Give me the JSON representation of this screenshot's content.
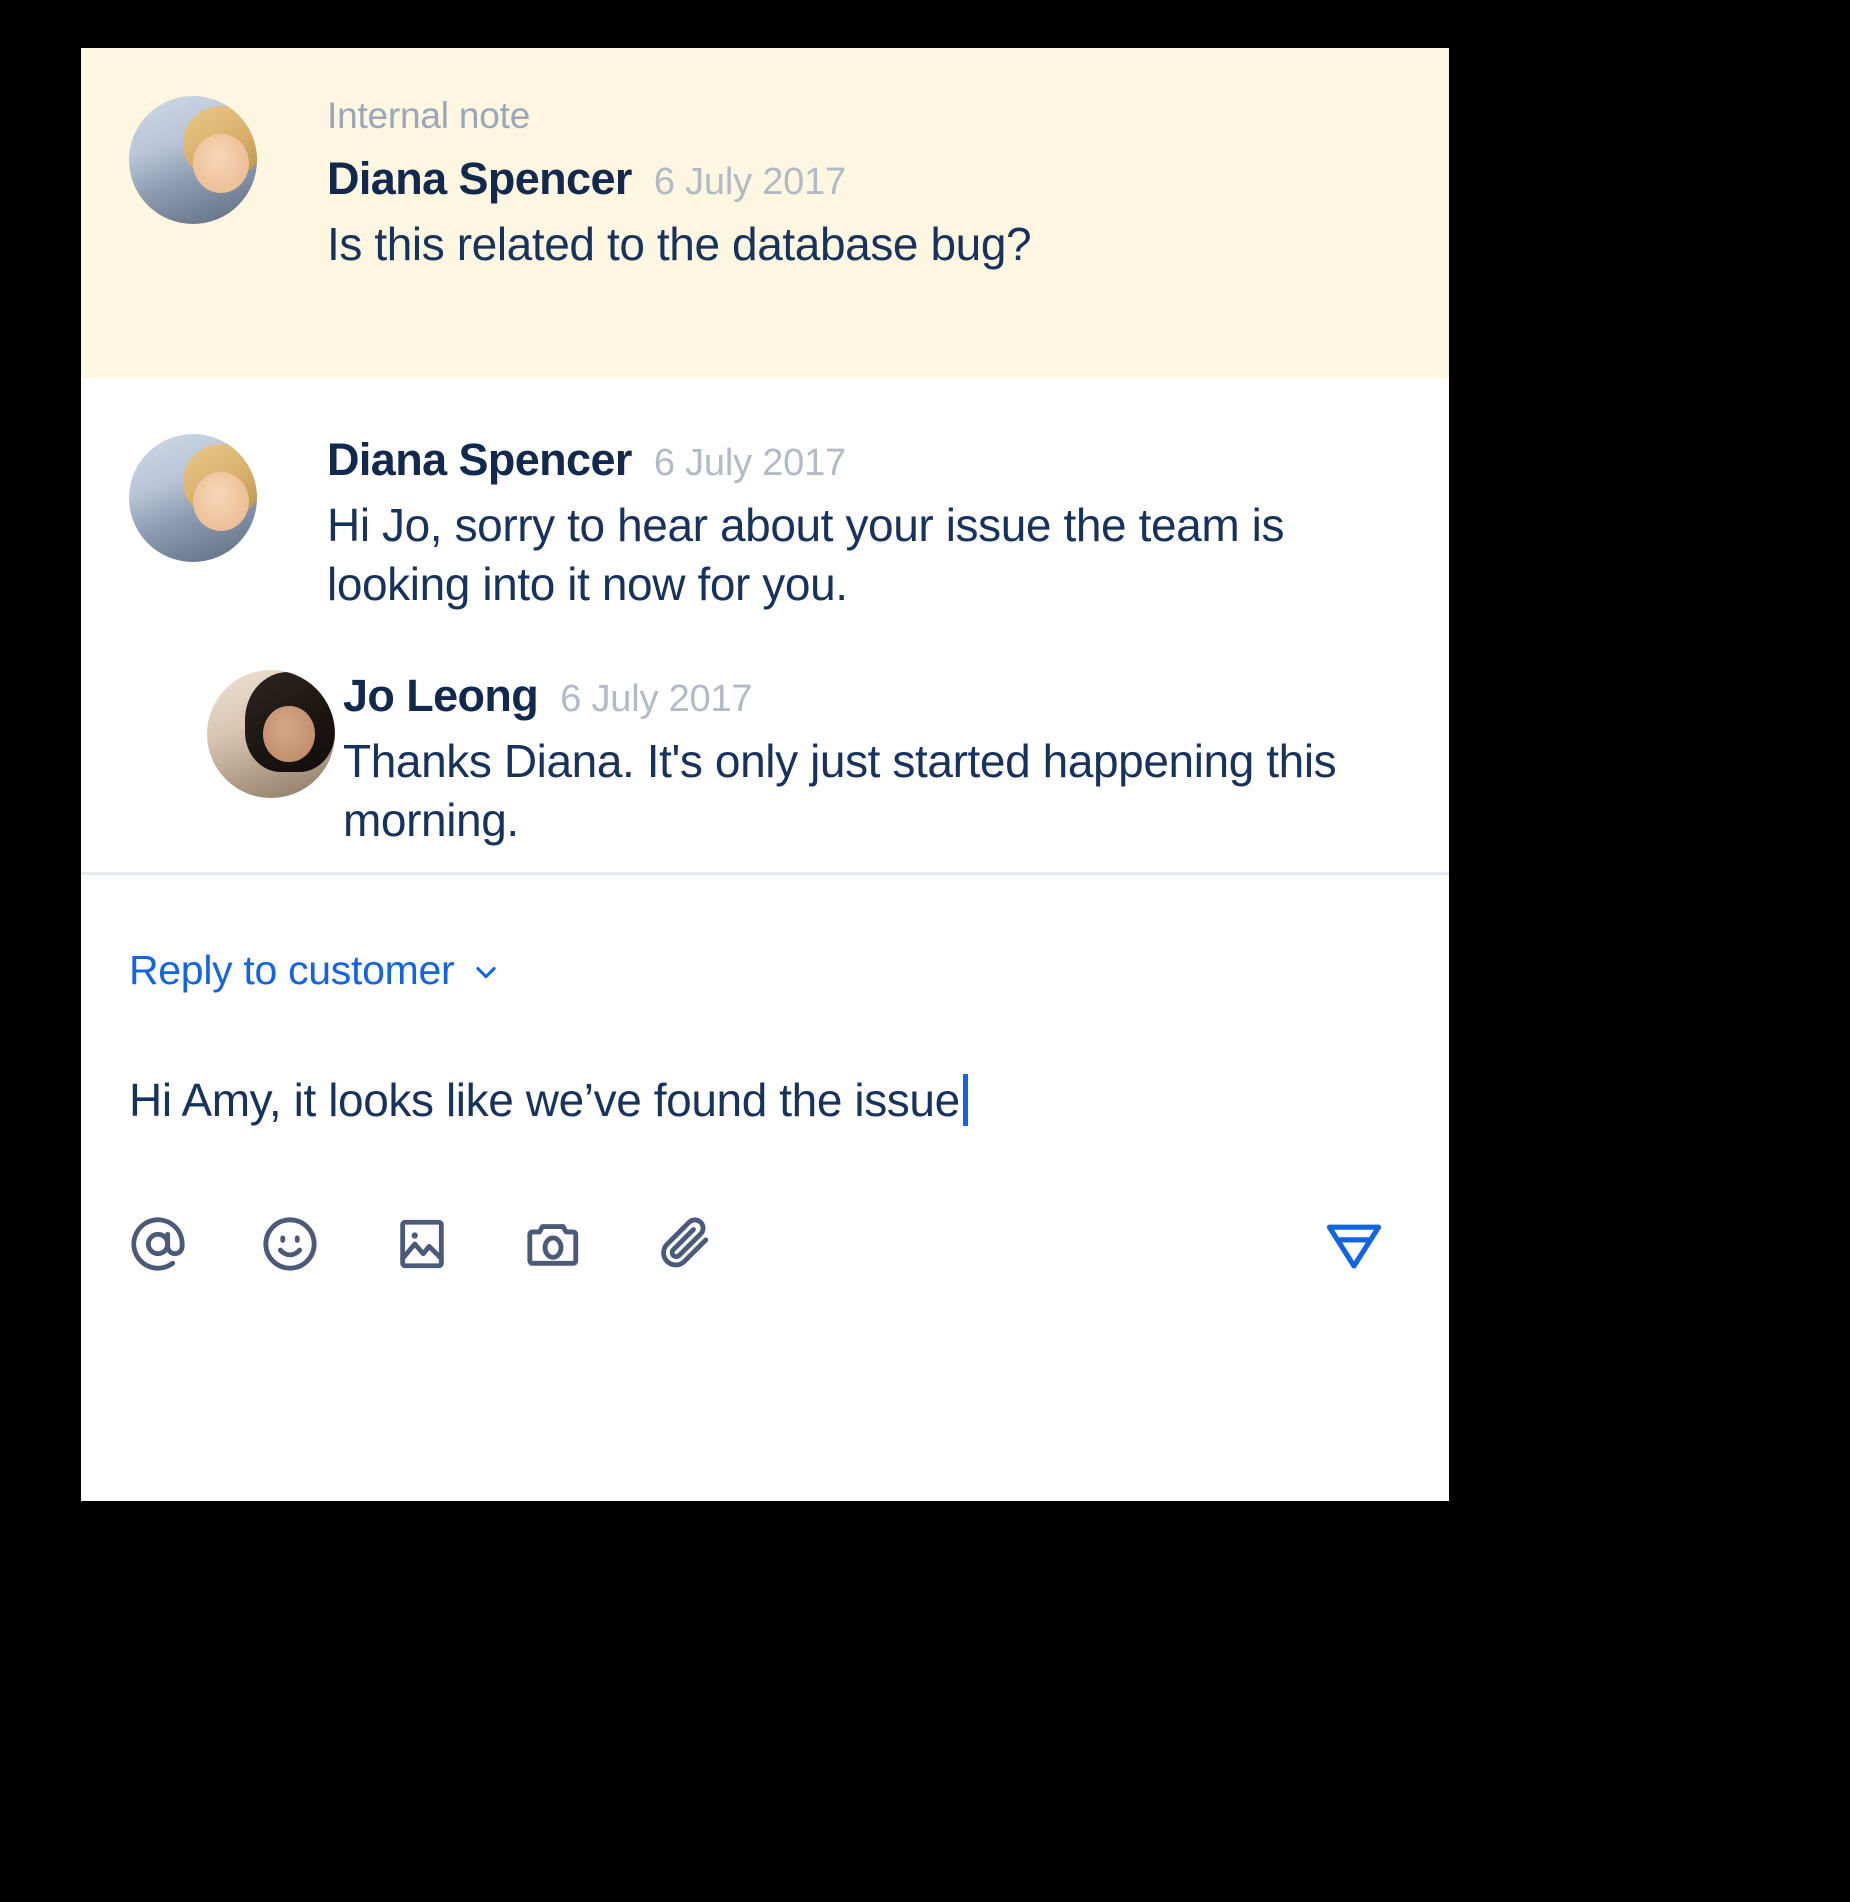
{
  "colors": {
    "note_background": "#fdf6e0",
    "card_background": "#ffffff",
    "page_background": "#000000",
    "text_primary": "#17325c",
    "text_muted": "#b2bac6",
    "label_muted": "#9ba7b8",
    "accent_blue": "#1264e0",
    "icon_gray": "#4a5a78",
    "divider": "#e4e9f0"
  },
  "internal_note": {
    "label": "Internal note",
    "author": "Diana Spencer",
    "timestamp": "6 July 2017",
    "body": "Is this related to the database bug?",
    "avatar_name": "diana-avatar"
  },
  "thread": {
    "messages": [
      {
        "author": "Diana Spencer",
        "timestamp": "6 July 2017",
        "body": "Hi Jo, sorry to hear about your issue the team is looking into it now for you.",
        "avatar_name": "diana-avatar"
      },
      {
        "author": "Jo Leong",
        "timestamp": "6 July 2017",
        "body": "Thanks Diana. It's only just started happening this morning.",
        "avatar_name": "jo-avatar"
      }
    ]
  },
  "composer": {
    "reply_mode_label": "Reply to customer",
    "chevron_icon": "chevron-down-icon",
    "draft_text": "Hi Amy, it looks like we’ve found the issue",
    "toolbar": [
      {
        "icon": "mention-icon",
        "label": "Mention"
      },
      {
        "icon": "emoji-icon",
        "label": "Emoji"
      },
      {
        "icon": "image-icon",
        "label": "Insert image"
      },
      {
        "icon": "camera-icon",
        "label": "Take photo"
      },
      {
        "icon": "paperclip-icon",
        "label": "Attach file"
      }
    ],
    "send": {
      "icon": "send-icon",
      "label": "Send"
    }
  }
}
